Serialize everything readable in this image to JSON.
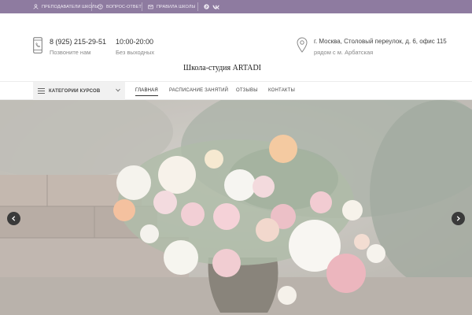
{
  "topbar": {
    "items": [
      {
        "label": "Преподаватели школы",
        "icon": "teacher-icon"
      },
      {
        "label": "Вопрос-ответ",
        "icon": "question-icon"
      },
      {
        "label": "Правила школы",
        "icon": "rules-icon"
      }
    ],
    "social": [
      {
        "label": "℗",
        "icon": "pinterest-icon"
      },
      {
        "label": "vk",
        "icon": "vk-icon"
      }
    ],
    "bg_color": "#8e7ba0"
  },
  "header": {
    "phone": "8 (925) 215-29-51",
    "call_label": "Позвоните нам",
    "hours": "10:00-20:00",
    "days": "Без выходных",
    "address": "г. Москва, Столовый переулок, д. 6, офис 115",
    "metro": "рядом с м. Арбатская",
    "site_name": "Школа-студия ARTADI"
  },
  "nav": {
    "categories_label": "Категории курсов",
    "links": [
      {
        "label": "Главная",
        "active": true
      },
      {
        "label": "Расписание занятий",
        "active": false
      },
      {
        "label": "Отзывы",
        "active": false
      },
      {
        "label": "Контакты",
        "active": false
      }
    ]
  },
  "slider": {
    "image": "flower-bouquet-photo",
    "prev_icon": "chevron-left-icon",
    "next_icon": "chevron-right-icon"
  }
}
